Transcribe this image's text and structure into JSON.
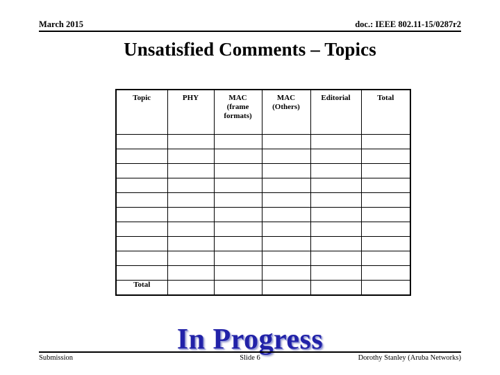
{
  "header": {
    "date": "March 2015",
    "doc": "doc.: IEEE 802.11-15/0287r2"
  },
  "title": "Unsatisfied Comments – Topics",
  "table": {
    "columns": [
      "Topic",
      "PHY",
      "MAC (frame formats)",
      "MAC (Others)",
      "Editorial",
      "Total"
    ],
    "column_labels": {
      "topic": "Topic",
      "phy": "PHY",
      "mac_frame_formats_line1": "MAC",
      "mac_frame_formats_line2": "(frame",
      "mac_frame_formats_line3": "formats)",
      "mac_others_line1": "MAC",
      "mac_others_line2": "(Others)",
      "editorial": "Editorial",
      "total": "Total"
    },
    "body_rows": [
      {
        "cells": [
          "",
          "",
          "",
          "",
          "",
          ""
        ]
      },
      {
        "cells": [
          "",
          "",
          "",
          "",
          "",
          ""
        ]
      },
      {
        "cells": [
          "",
          "",
          "",
          "",
          "",
          ""
        ]
      },
      {
        "cells": [
          "",
          "",
          "",
          "",
          "",
          ""
        ]
      },
      {
        "cells": [
          "",
          "",
          "",
          "",
          "",
          ""
        ]
      },
      {
        "cells": [
          "",
          "",
          "",
          "",
          "",
          ""
        ]
      },
      {
        "cells": [
          "",
          "",
          "",
          "",
          "",
          ""
        ]
      },
      {
        "cells": [
          "",
          "",
          "",
          "",
          "",
          ""
        ]
      },
      {
        "cells": [
          "",
          "",
          "",
          "",
          "",
          ""
        ]
      },
      {
        "cells": [
          "",
          "",
          "",
          "",
          "",
          ""
        ]
      }
    ],
    "total_row": {
      "label": "Total",
      "cells": [
        "",
        "",
        "",
        "",
        ""
      ]
    }
  },
  "status_text": "In Progress",
  "footer": {
    "left": "Submission",
    "center": "Slide 6",
    "right": "Dorothy Stanley (Aruba Networks)"
  },
  "colors": {
    "shaded_cell": "#e6e6e6",
    "border": "#000000",
    "status_blue": "#2222a8",
    "text": "#000000"
  }
}
